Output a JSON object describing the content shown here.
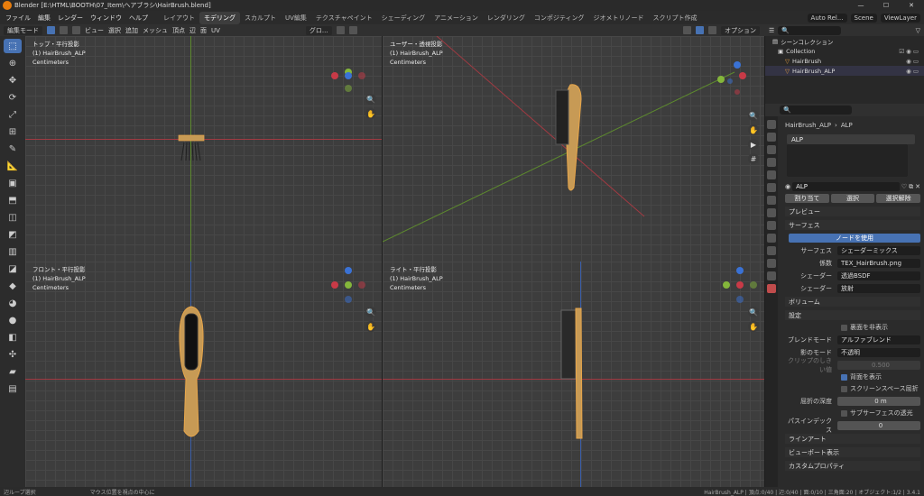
{
  "window": {
    "title": "Blender [E:\\HTML\\BOOTH\\07_Item\\ヘアブラシ\\HairBrush.blend]",
    "controls": [
      "—",
      "☐",
      "✕"
    ]
  },
  "menu": [
    "ファイル",
    "編集",
    "レンダー",
    "ウィンドウ",
    "ヘルプ"
  ],
  "workspaces": [
    "レイアウト",
    "モデリング",
    "スカルプト",
    "UV編集",
    "テクスチャペイント",
    "シェーディング",
    "アニメーション",
    "レンダリング",
    "コンポジティング",
    "ジオメトリノード",
    "スクリプト作成"
  ],
  "active_workspace": 1,
  "topright": {
    "render_engine": "Auto Rel...",
    "scene": "Scene",
    "view_layer": "ViewLayer"
  },
  "header": {
    "mode": "編集モード",
    "menus": [
      "ビュー",
      "選択",
      "追加",
      "メッシュ",
      "頂点",
      "辺",
      "面",
      "UV"
    ],
    "orientation": "グロ...",
    "options": "オプション"
  },
  "viewports": [
    {
      "view": "トップ・平行投影",
      "object": "(1) HairBrush_ALP",
      "unit": "Centimeters"
    },
    {
      "view": "ユーザー・透視投影",
      "object": "(1) HairBrush_ALP",
      "unit": "Centimeters"
    },
    {
      "view": "フロント・平行投影",
      "object": "(1) HairBrush_ALP",
      "unit": "Centimeters"
    },
    {
      "view": "ライト・平行投影",
      "object": "(1) HairBrush_ALP",
      "unit": "Centimeters"
    }
  ],
  "outliner": {
    "root": "シーンコレクション",
    "collection": "Collection",
    "items": [
      "HairBrush",
      "HairBrush_ALP"
    ]
  },
  "properties": {
    "breadcrumb": [
      "HairBrush_ALP",
      "ALP"
    ],
    "slot": "ALP",
    "material": "ALP",
    "buttons": [
      "割り当て",
      "選択",
      "選択解除"
    ],
    "panels": {
      "preview": "プレビュー",
      "surface": "サーフェス",
      "volume": "ボリューム",
      "settings": "設定",
      "lineart": "ラインアート",
      "viewport": "ビューポート表示",
      "custom": "カスタムプロパティ"
    },
    "use_nodes": "ノードを使用",
    "surface_rows": [
      {
        "k": "サーフェス",
        "v": "シェーダーミックス"
      },
      {
        "k": "係数",
        "v": "TEX_HairBrush.png"
      },
      {
        "k": "シェーダー",
        "v": "透過BSDF"
      },
      {
        "k": "シェーダー",
        "v": "放射"
      }
    ],
    "settings": {
      "backface": "裏面を非表示",
      "blend_mode_label": "ブレンドモード",
      "blend_mode": "アルファブレンド",
      "shadow_mode_label": "影のモード",
      "shadow_mode": "不透明",
      "clip_label": "クリップのしきい値",
      "clip": "0.500",
      "show_backface": "背面を表示",
      "ssr": "スクリーンスペース屈折",
      "depth_label": "屈折の深度",
      "depth": "0 m",
      "sss": "サブサーフェスの透光",
      "pass_label": "パスインデックス",
      "pass": "0"
    }
  },
  "status": {
    "left1": "辺ループ選択",
    "left2": "マウス位置を視点の中心に",
    "right": "HairBrush_ALP | 頂点:0/40 | 辺:0/40 | 面:0/10 | 三角面:20 | オブジェクト:1/2 | 3.4.1"
  },
  "colors": {
    "accent": "#4772b3",
    "x_axis": "#a13a42",
    "y_axis": "#5d8a2e",
    "z_axis": "#3a5ea8",
    "brush": "#c79a55"
  }
}
